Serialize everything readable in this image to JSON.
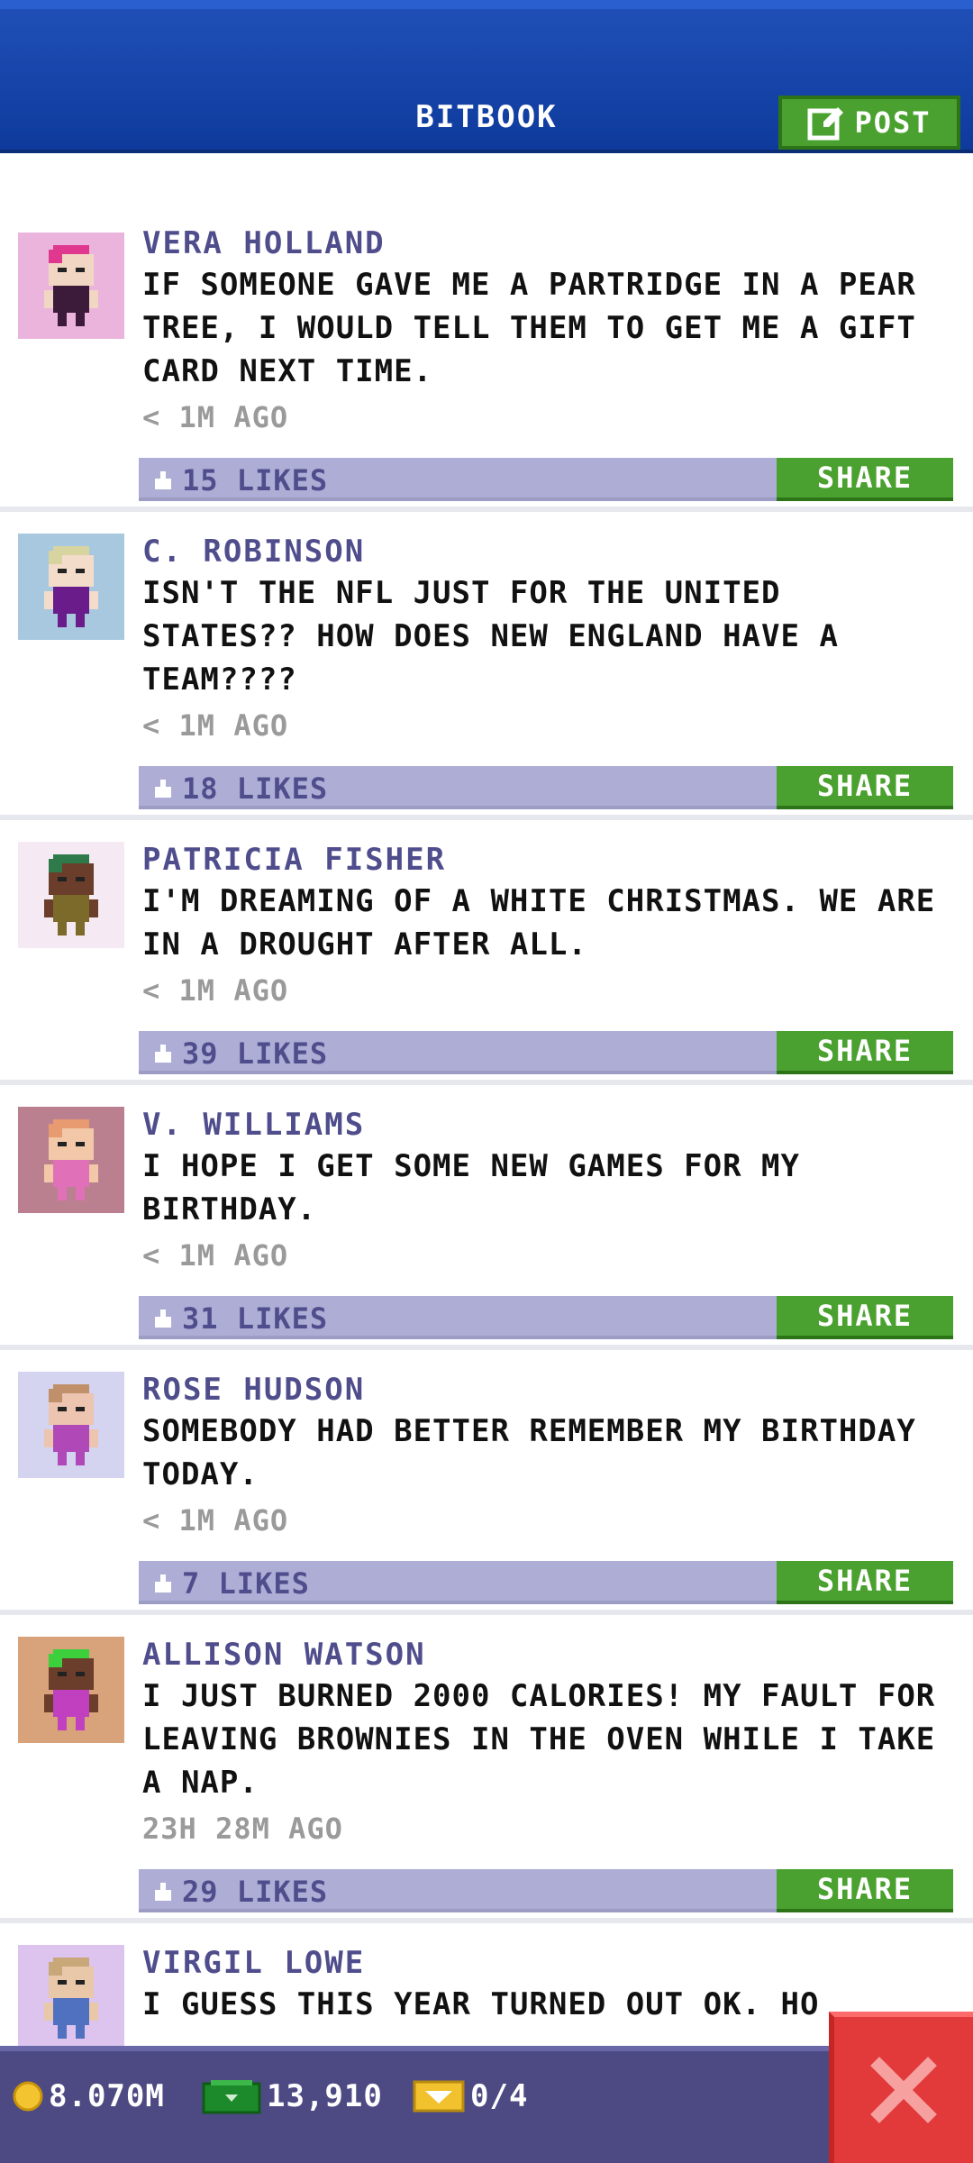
{
  "header": {
    "title": "BITBOOK",
    "post_label": "POST"
  },
  "posts": [
    {
      "name": "VERA HOLLAND",
      "text": "IF SOMEONE GAVE ME A PARTRIDGE IN A PEAR TREE, I WOULD TELL THEM TO GET ME A GIFT CARD NEXT TIME.",
      "time": "< 1M AGO",
      "likes": "15 LIKES",
      "share": "SHARE",
      "avatar_bg": "#ebb4dc",
      "hair": "#e0388f",
      "skin": "#f1d7c3",
      "shirt": "#3b1a3a"
    },
    {
      "name": "C. ROBINSON",
      "text": "ISN'T THE NFL JUST FOR THE UNITED STATES?? HOW DOES NEW ENGLAND HAVE A TEAM????",
      "time": "< 1M AGO",
      "likes": "18 LIKES",
      "share": "SHARE",
      "avatar_bg": "#a8c8e0",
      "hair": "#d8d4a0",
      "skin": "#f3dcc9",
      "shirt": "#6a1d8a"
    },
    {
      "name": "PATRICIA FISHER",
      "text": "I'M DREAMING OF A WHITE CHRISTMAS. WE ARE IN A DROUGHT AFTER ALL.",
      "time": "< 1M AGO",
      "likes": "39 LIKES",
      "share": "SHARE",
      "avatar_bg": "#f5e9f3",
      "hair": "#2e7a4a",
      "skin": "#6a3e2a",
      "shirt": "#7c6a2a"
    },
    {
      "name": "V. WILLIAMS",
      "text": "I HOPE I GET SOME NEW GAMES FOR MY BIRTHDAY.",
      "time": "< 1M AGO",
      "likes": "31 LIKES",
      "share": "SHARE",
      "avatar_bg": "#bb8090",
      "hair": "#e89a70",
      "skin": "#f2c8a8",
      "shirt": "#e070b8"
    },
    {
      "name": "ROSE HUDSON",
      "text": "SOMEBODY HAD BETTER REMEMBER MY BIRTHDAY TODAY.",
      "time": "< 1M AGO",
      "likes": "7 LIKES",
      "share": "SHARE",
      "avatar_bg": "#d4d4f0",
      "hair": "#c0906a",
      "skin": "#ecc4b0",
      "shirt": "#b048b8"
    },
    {
      "name": "ALLISON WATSON",
      "text": "I JUST BURNED 2000 CALORIES! MY FAULT FOR LEAVING BROWNIES IN THE OVEN WHILE I TAKE A NAP.",
      "time": "23H 28M AGO",
      "likes": "29 LIKES",
      "share": "SHARE",
      "avatar_bg": "#d8a27a",
      "hair": "#3cd03c",
      "skin": "#6a3e2a",
      "shirt": "#c040c0"
    },
    {
      "name": "VIRGIL LOWE",
      "text": "I GUESS THIS YEAR TURNED OUT OK. HO",
      "time": "",
      "likes": "",
      "share": "",
      "avatar_bg": "#dcc4ee",
      "hair": "#c8a878",
      "skin": "#e8c8a8",
      "shirt": "#5070c0"
    }
  ],
  "bottom": {
    "coins": "8.070M",
    "cash": "13,910",
    "tickets": "0/4"
  },
  "colors": {
    "accent_green": "#4aa12f",
    "header_blue": "#0e3a9c",
    "bar_purple": "#adadd5",
    "close_red": "#e23a3a"
  }
}
